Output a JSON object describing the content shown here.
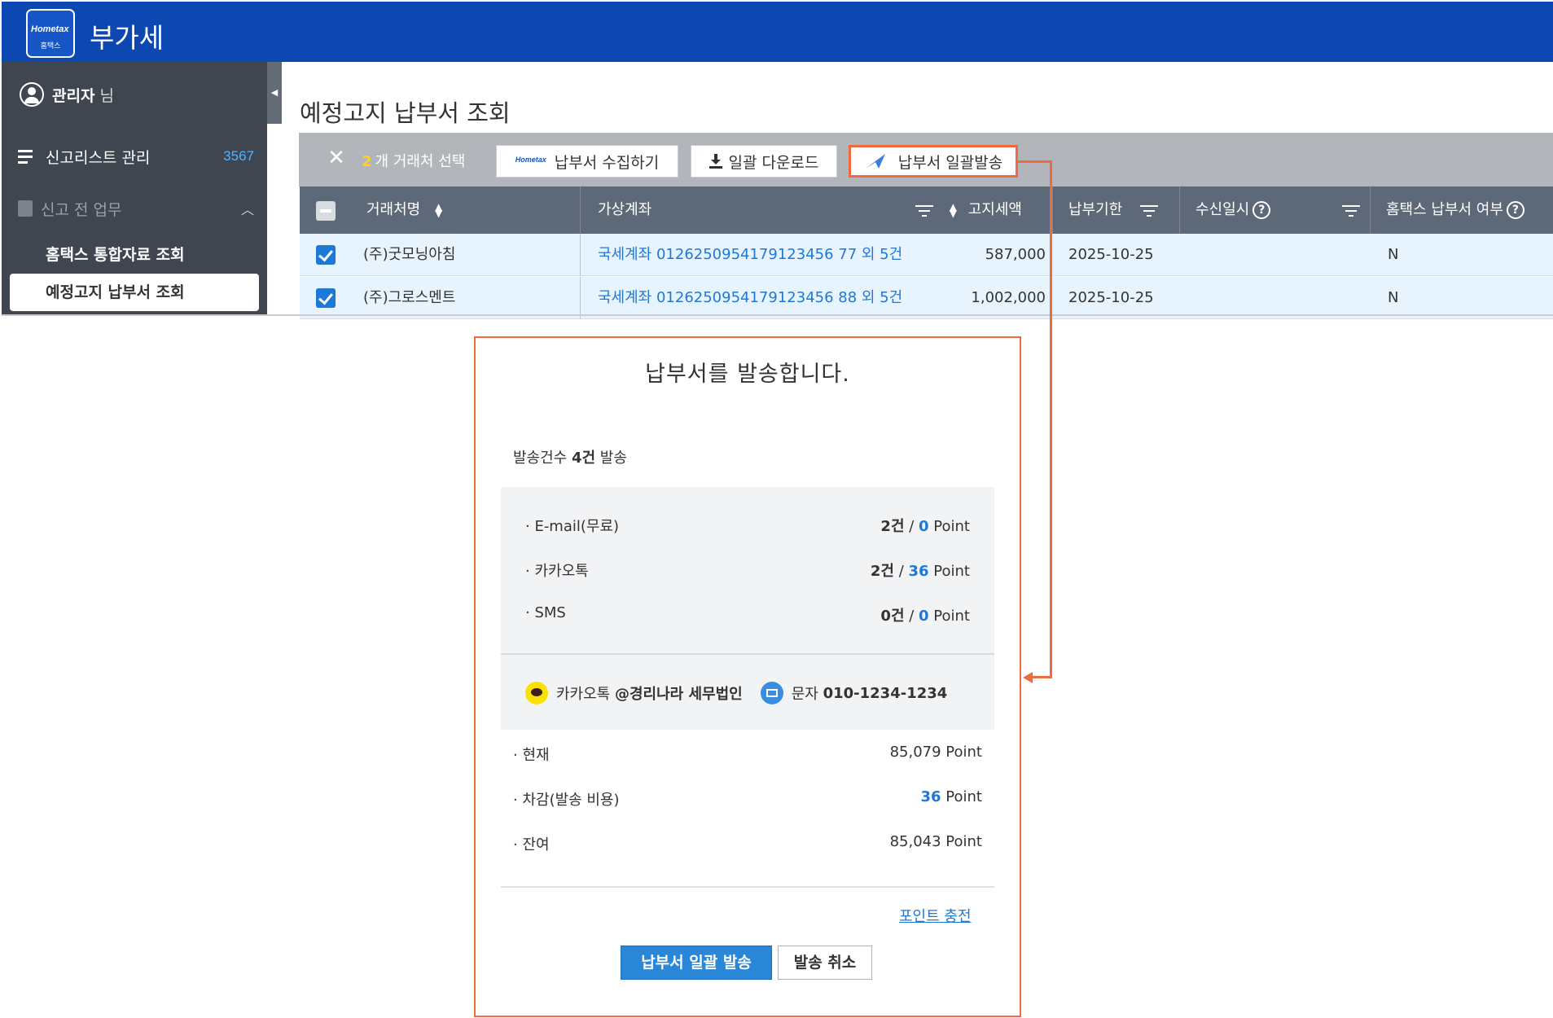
{
  "header": {
    "app_title": "부가세",
    "logo_text": "Hometax",
    "logo_sub": "홈택스",
    "bg_color": "#0d47b2"
  },
  "sidebar": {
    "user_name": "관리자",
    "user_suffix": "님",
    "menu_report_list": "신고리스트 관리",
    "menu_report_count": "3567",
    "group_pre_report": "신고 전 업무",
    "sub_items": [
      "홈택스 통합자료 조회",
      "예정고지 납부서 조회"
    ]
  },
  "main": {
    "page_title": "예정고지 납부서 조회",
    "toolbar": {
      "selected_count": "2",
      "selected_text": "개 거래처 선택",
      "collect_button": "납부서 수집하기",
      "download_button": "일괄 다운로드",
      "send_button": "납부서 일괄발송"
    },
    "table": {
      "headers": {
        "name": "거래처명",
        "account": "가상계좌",
        "amount": "고지세액",
        "due": "납부기한",
        "received": "수신일시",
        "hometax": "홈택스 납부서 여부"
      },
      "rows": [
        {
          "name": "(주)굿모닝아침",
          "account": "국세계좌 0126250954179123456 77 외 5건",
          "amount": "587,000",
          "due": "2025-10-25",
          "received": "",
          "hometax": "N"
        },
        {
          "name": "(주)그로스멘트",
          "account": "국세계좌 0126250954179123456 88 외 5건",
          "amount": "1,002,000",
          "due": "2025-10-25",
          "received": "",
          "hometax": "N"
        }
      ]
    }
  },
  "modal": {
    "title": "납부서를 발송합니다.",
    "count_prefix": "발송건수 ",
    "count_value": "4건",
    "count_suffix": " 발송",
    "stats": [
      {
        "label": "· E-mail(무료)",
        "count": "2건",
        "points": "0",
        "unit": "Point"
      },
      {
        "label": "· 카카오톡",
        "count": "2건",
        "points": "36",
        "unit": "Point"
      },
      {
        "label": "· SMS",
        "count": "0건",
        "points": "0",
        "unit": "Point"
      }
    ],
    "kakao_label": "카카오톡",
    "kakao_channel": "@경리나라 세무법인",
    "sms_label": "문자",
    "sms_number": "010-1234-1234",
    "balance": [
      {
        "label": "· 현재",
        "value": "85,079 Point"
      },
      {
        "label": "· 차감(발송 비용)",
        "value_num": "36",
        "value_unit": " Point"
      },
      {
        "label": "· 잔여",
        "value": "85,043 Point"
      }
    ],
    "charge_link": "포인트 충전",
    "confirm_button": "납부서 일괄 발송",
    "cancel_button": "발송 취소"
  },
  "colors": {
    "accent": "#ef6a3e",
    "primary": "#2a87d8",
    "link": "#1e78d8"
  }
}
